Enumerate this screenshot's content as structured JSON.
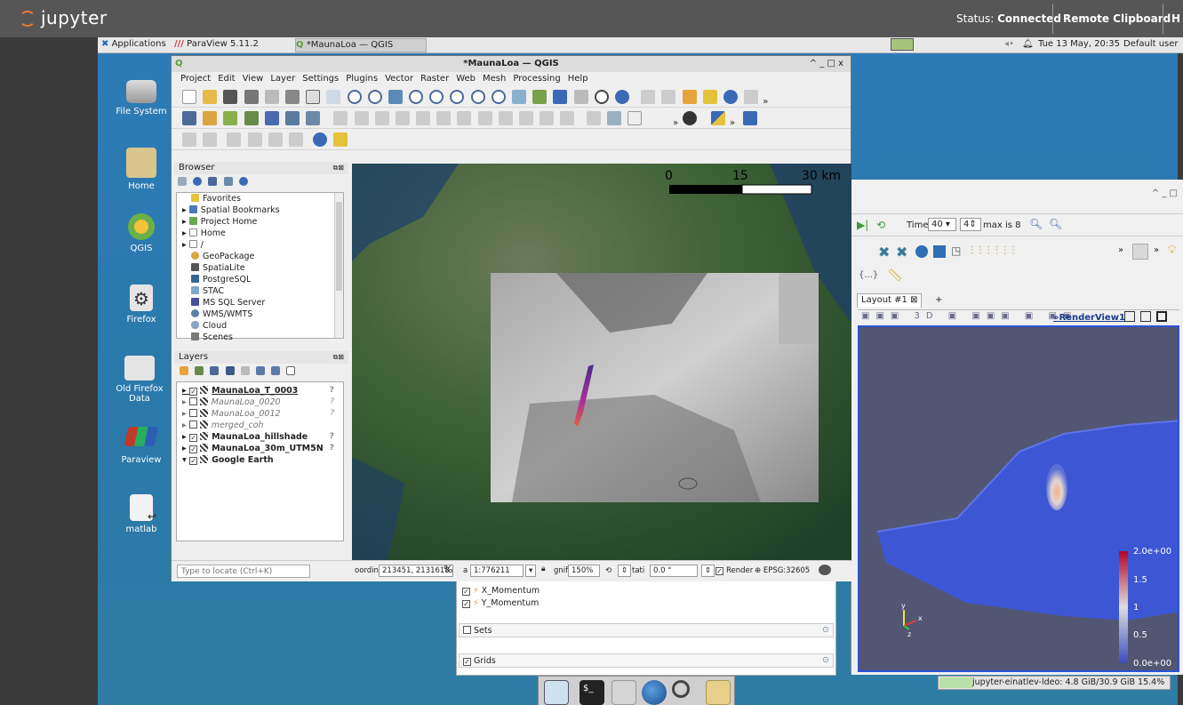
{
  "jupyter": {
    "logo_text": "jupyter",
    "status_label": "Status:",
    "status_value": "Connected",
    "remote_clipboard": "Remote Clipboard",
    "trailing": "H"
  },
  "panel": {
    "applications": "Applications",
    "paraview_task": "ParaView 5.11.2",
    "qgis_task": "*MaunaLoa — QGIS",
    "datetime": "Tue 13 May, 20:35",
    "user": "Default user"
  },
  "desktop_icons": [
    {
      "label": "File System",
      "icon": "drive-icon"
    },
    {
      "label": "Home",
      "icon": "home-folder-icon"
    },
    {
      "label": "QGIS",
      "icon": "qgis-icon"
    },
    {
      "label": "Firefox",
      "icon": "gear-icon"
    },
    {
      "label": "Old Firefox Data",
      "icon": "folder-icon"
    },
    {
      "label": "Paraview",
      "icon": "paraview-icon"
    },
    {
      "label": "matlab",
      "icon": "file-link-icon"
    }
  ],
  "qgis": {
    "title": "*MaunaLoa — QGIS",
    "window_controls": "^ _ □ x",
    "menu": [
      "Project",
      "Edit",
      "View",
      "Layer",
      "Settings",
      "Plugins",
      "Vector",
      "Raster",
      "Web",
      "Mesh",
      "Processing",
      "Help"
    ],
    "browser_title": "Browser",
    "browser_items": [
      {
        "label": "Favorites",
        "icon": "star-icon",
        "color": "#e8c33a"
      },
      {
        "label": "Spatial Bookmarks",
        "icon": "bookmark-icon",
        "color": "#4a7ab8"
      },
      {
        "label": "Project Home",
        "icon": "project-folder-icon",
        "color": "#6aa84f"
      },
      {
        "label": "Home",
        "icon": "home-icon",
        "color": "#888888"
      },
      {
        "label": "/",
        "icon": "folder-icon",
        "color": "#888888"
      },
      {
        "label": "GeoPackage",
        "icon": "geopackage-icon",
        "color": "#d9a441"
      },
      {
        "label": "SpatiaLite",
        "icon": "feather-icon",
        "color": "#555555"
      },
      {
        "label": "PostgreSQL",
        "icon": "elephant-icon",
        "color": "#336791"
      },
      {
        "label": "STAC",
        "icon": "stac-icon",
        "color": "#7fa9c9"
      },
      {
        "label": "MS SQL Server",
        "icon": "mssql-icon",
        "color": "#4b4e9c"
      },
      {
        "label": "WMS/WMTS",
        "icon": "globe-icon",
        "color": "#5a7fa8"
      },
      {
        "label": "Cloud",
        "icon": "cloud-icon",
        "color": "#8aa5c4"
      },
      {
        "label": "Scenes",
        "icon": "scenes-icon",
        "color": "#7a7a7a"
      }
    ],
    "layers_title": "Layers",
    "layers": [
      {
        "name": "MaunaLoa_T_0003",
        "checked": true,
        "style": "bold-underline",
        "help": "?"
      },
      {
        "name": "MaunaLoa_0020",
        "checked": false,
        "style": "italic",
        "help": "?"
      },
      {
        "name": "MaunaLoa_0012",
        "checked": false,
        "style": "italic",
        "help": "?"
      },
      {
        "name": "merged_coh",
        "checked": false,
        "style": "italic",
        "help": ""
      },
      {
        "name": "MaunaLoa_hillshade",
        "checked": true,
        "style": "bold",
        "help": "?"
      },
      {
        "name": "MaunaLoa_30m_UTM5N",
        "checked": true,
        "style": "bold",
        "help": "?"
      },
      {
        "name": "Google Earth",
        "checked": true,
        "style": "bold",
        "help": ""
      }
    ],
    "scalebar": {
      "labels": [
        "0",
        "15",
        "30 km"
      ]
    },
    "locate_placeholder": "Type to locate (Ctrl+K)",
    "status": {
      "coord_label": "oordina",
      "coord_value": "213451, 2131618",
      "scale_label": "a",
      "scale_value": "1:776211",
      "mag_label": "gnifi",
      "mag_value": "150%",
      "rot_label": "tati",
      "rot_value": "0.0 °",
      "render": "Render",
      "crs": "EPSG:32605"
    }
  },
  "paraview": {
    "window_controls": "^ _ □",
    "time_label": "Time:",
    "time_value": "40",
    "time_step": "4",
    "max_text": "max is 8",
    "layout_tab": "Layout #1",
    "add_tab": "+",
    "render_view": "RenderView1",
    "colorbar_labels": [
      "2.0e+00",
      "1.5",
      "1",
      "0.5",
      "0.0e+00"
    ],
    "axes": {
      "y": "y",
      "x": "x",
      "z": "z"
    },
    "lower_panel": {
      "items": [
        "X_Momentum",
        "Y_Momentum"
      ],
      "sets_label": "Sets",
      "grids_label": "Grids"
    }
  },
  "memory": "jupyter-einatlev-ldeo: 4.8 GiB/30.9 GiB 15.4%"
}
